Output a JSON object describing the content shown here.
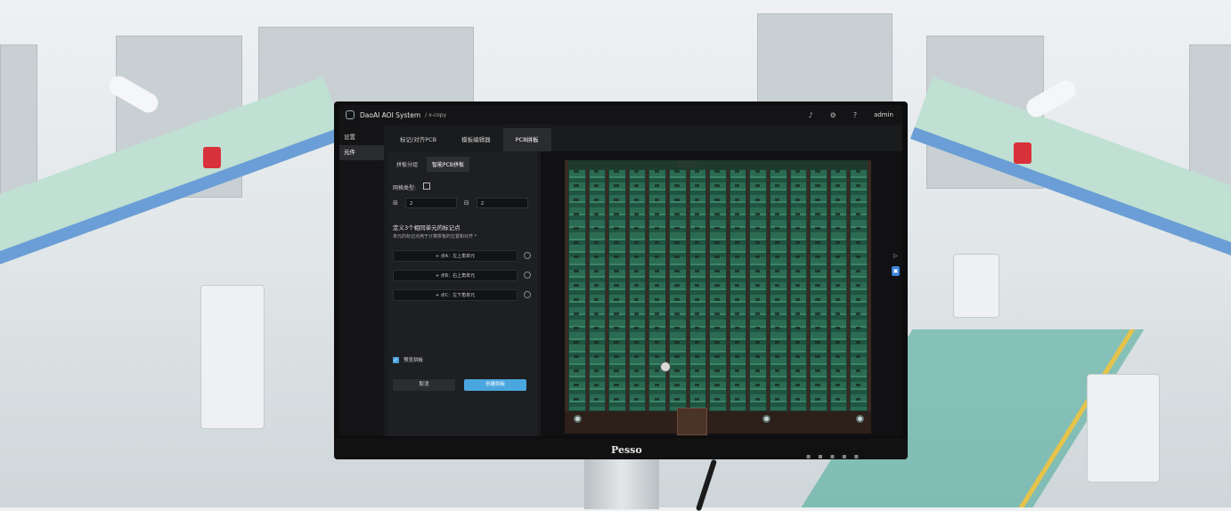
{
  "app": {
    "title": "DaoAI AOI System",
    "subtitle": "/ x-copy",
    "user": "admin",
    "icons": [
      "bell-icon",
      "gear-icon",
      "help-icon"
    ]
  },
  "sidebar": {
    "items": [
      {
        "label": "设置",
        "active": false
      },
      {
        "label": "元件",
        "active": true
      }
    ]
  },
  "tabs": [
    {
      "label": "标记/对齐PCB",
      "active": false
    },
    {
      "label": "模板编辑器",
      "active": false
    },
    {
      "label": "PCB拼板",
      "active": true
    }
  ],
  "panel": {
    "subtabs": [
      {
        "label": "拼板分组",
        "active": false
      },
      {
        "label": "智能PCB拼板",
        "active": true
      }
    ],
    "grid_type_label": "网格类型:",
    "columns_value": "2",
    "rows_value": "2",
    "section_title": "定义3个相同单元的标记点",
    "section_note": "单元的标记点用于计算拼板的位置和对齐 *",
    "points": [
      {
        "label": "+ 点A：左上角单元"
      },
      {
        "label": "+ 点B：右上角单元"
      },
      {
        "label": "+ 点C：左下角单元"
      }
    ],
    "preview_checkbox": {
      "label": "预览拼板",
      "checked": true
    },
    "cancel_label": "取消",
    "create_label": "创建拼板"
  },
  "monitor": {
    "brand": "Pesso"
  },
  "colors": {
    "accent": "#4aa6df",
    "pcb_green": "#2b6b53",
    "background_dark": "#1a1b1d"
  }
}
